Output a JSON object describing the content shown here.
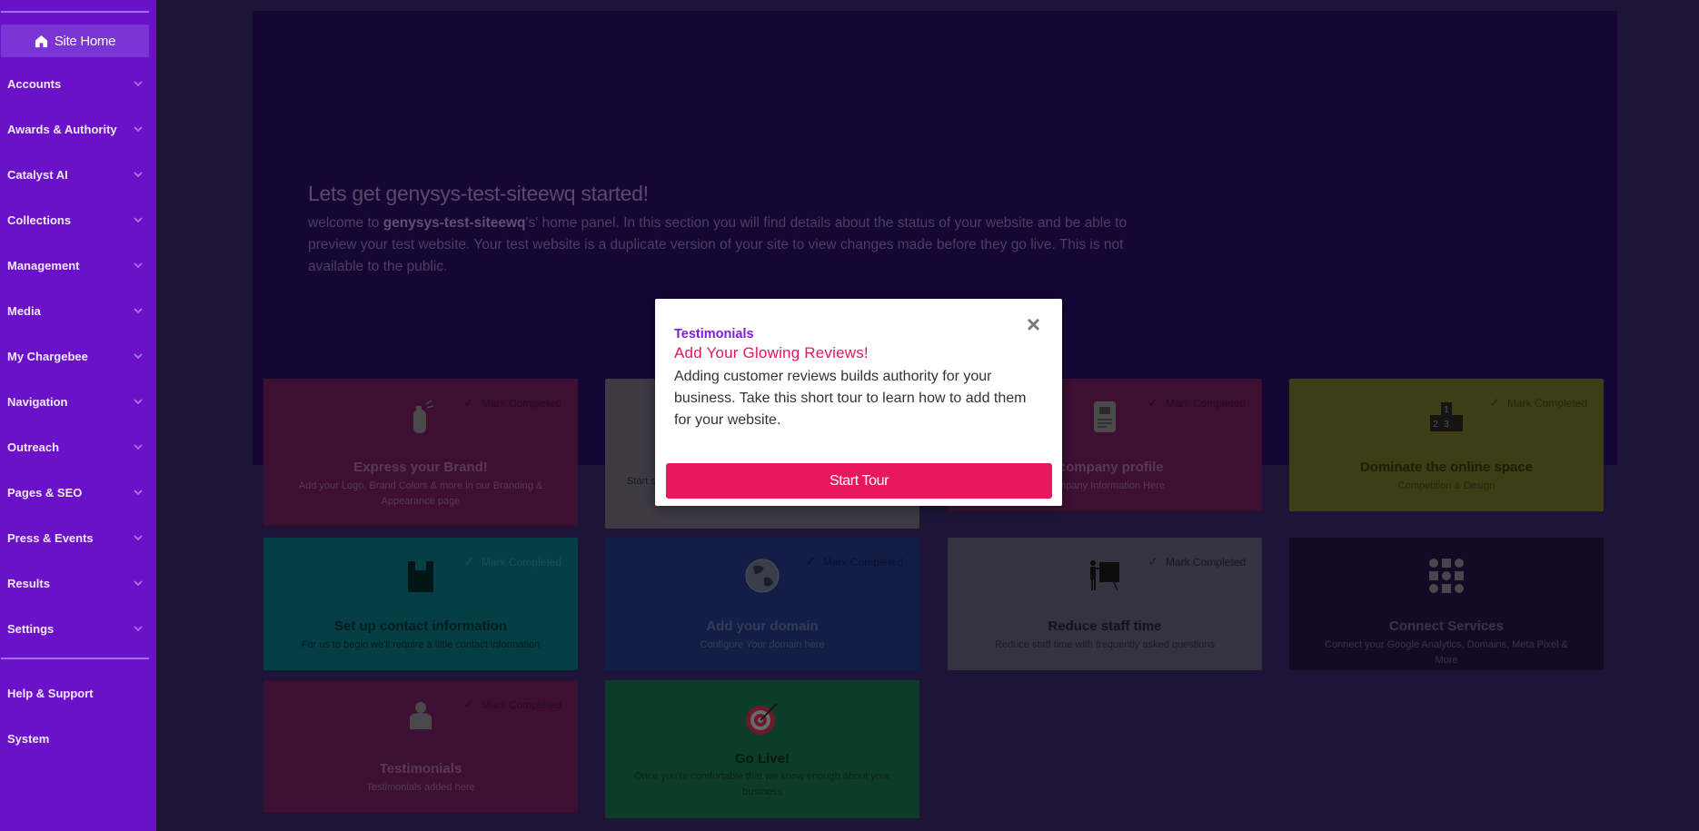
{
  "sidebar": {
    "site_home": {
      "label": "Site Home",
      "icon": "home-icon"
    },
    "items": [
      {
        "label": "Accounts"
      },
      {
        "label": "Awards & Authority"
      },
      {
        "label": "Catalyst AI"
      },
      {
        "label": "Collections"
      },
      {
        "label": "Management"
      },
      {
        "label": "Media"
      },
      {
        "label": "My Chargebee"
      },
      {
        "label": "Navigation"
      },
      {
        "label": "Outreach"
      },
      {
        "label": "Pages & SEO"
      },
      {
        "label": "Press & Events"
      },
      {
        "label": "Results"
      },
      {
        "label": "Settings"
      }
    ],
    "bottom_items": [
      {
        "label": "Help & Support"
      },
      {
        "label": "System"
      }
    ]
  },
  "hero": {
    "title": "Lets get genysys-test-siteewq started!",
    "text_prefix": "welcome to ",
    "site_name": "genysys-test-siteewq",
    "text_suffix": "'s' home panel. In this section you will find details about the status of your website and be able to preview your test website. Your test website  is a duplicate version of your site to view changes made before they go live. This is not available to the public."
  },
  "cards": [
    {
      "title": "Express your Brand!",
      "desc": "Add your Logo, Brand Colors & more in our Branding & Appearance page",
      "mark": "Mark Completed",
      "icon": "spray-bottle-icon"
    },
    {
      "title": "",
      "desc": "Start s",
      "mark": "",
      "icon": ""
    },
    {
      "title": "p company profile",
      "desc": "Company Information Here",
      "mark": "Mark Completed",
      "icon": "company-document-icon"
    },
    {
      "title": "Dominate the online space",
      "desc": "Competition & Design",
      "mark": "Mark Completed",
      "icon": "podium-icon"
    },
    {
      "title": "Set up contact information",
      "desc": "For us to begin we'll require a little contact information",
      "mark": "Mark Completed",
      "icon": "contact-book-icon"
    },
    {
      "title": "Add your domain",
      "desc": "Configure Your domain here",
      "mark": "Mark Completed",
      "icon": "globe-icon"
    },
    {
      "title": "Reduce staff time",
      "desc": "Reduce staff time with frequently asked questions",
      "mark": "Mark Completed",
      "icon": "presentation-icon"
    },
    {
      "title": "Connect Services",
      "desc": "Connect your Google Analytics, Domains, Meta Pixel & More",
      "mark": "",
      "icon": "connections-icon"
    },
    {
      "title": "Testimonials",
      "desc": "Testimonials added here",
      "mark": "Mark Completed",
      "icon": "person-icon"
    },
    {
      "title": "Go Live!",
      "desc": "Once you're comfortable that we know enough about your business",
      "mark": "",
      "icon": "target-icon"
    }
  ],
  "modal": {
    "kicker": "Testimonials",
    "headline": "Add Your Glowing Reviews!",
    "body": "Adding customer reviews builds authority for your business. Take this short tour to learn how to add them for your website.",
    "button": "Start Tour",
    "close": "×"
  }
}
